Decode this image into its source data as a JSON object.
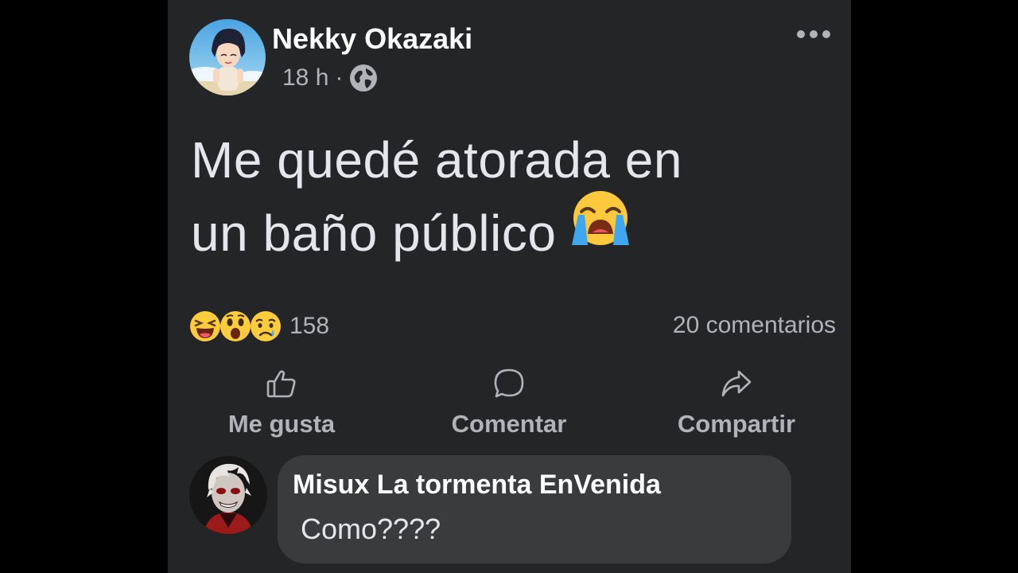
{
  "post": {
    "author_name": "Nekky Okazaki",
    "time": "18 h",
    "separator": "·",
    "audience_icon": "globe-icon",
    "more_icon": "more-dots-icon",
    "text_line1": "Me quedé atorada en",
    "text_line2": "un baño público",
    "text_emoji": "loudly-crying-face-emoji"
  },
  "engagement": {
    "reaction_icons": [
      "haha-reaction-icon",
      "wow-reaction-icon",
      "sad-reaction-icon"
    ],
    "reaction_count": "158",
    "comments_count": "20 comentarios"
  },
  "actions": {
    "like_label": "Me gusta",
    "comment_label": "Comentar",
    "share_label": "Compartir"
  },
  "comment": {
    "author_name": "Misux La tormenta EnVenida",
    "text": "Como????"
  },
  "colors": {
    "background": "#000000",
    "card": "#242526",
    "bubble": "#3a3b3c",
    "primary_text": "#e4e6eb",
    "secondary_text": "#b0b3b8"
  }
}
